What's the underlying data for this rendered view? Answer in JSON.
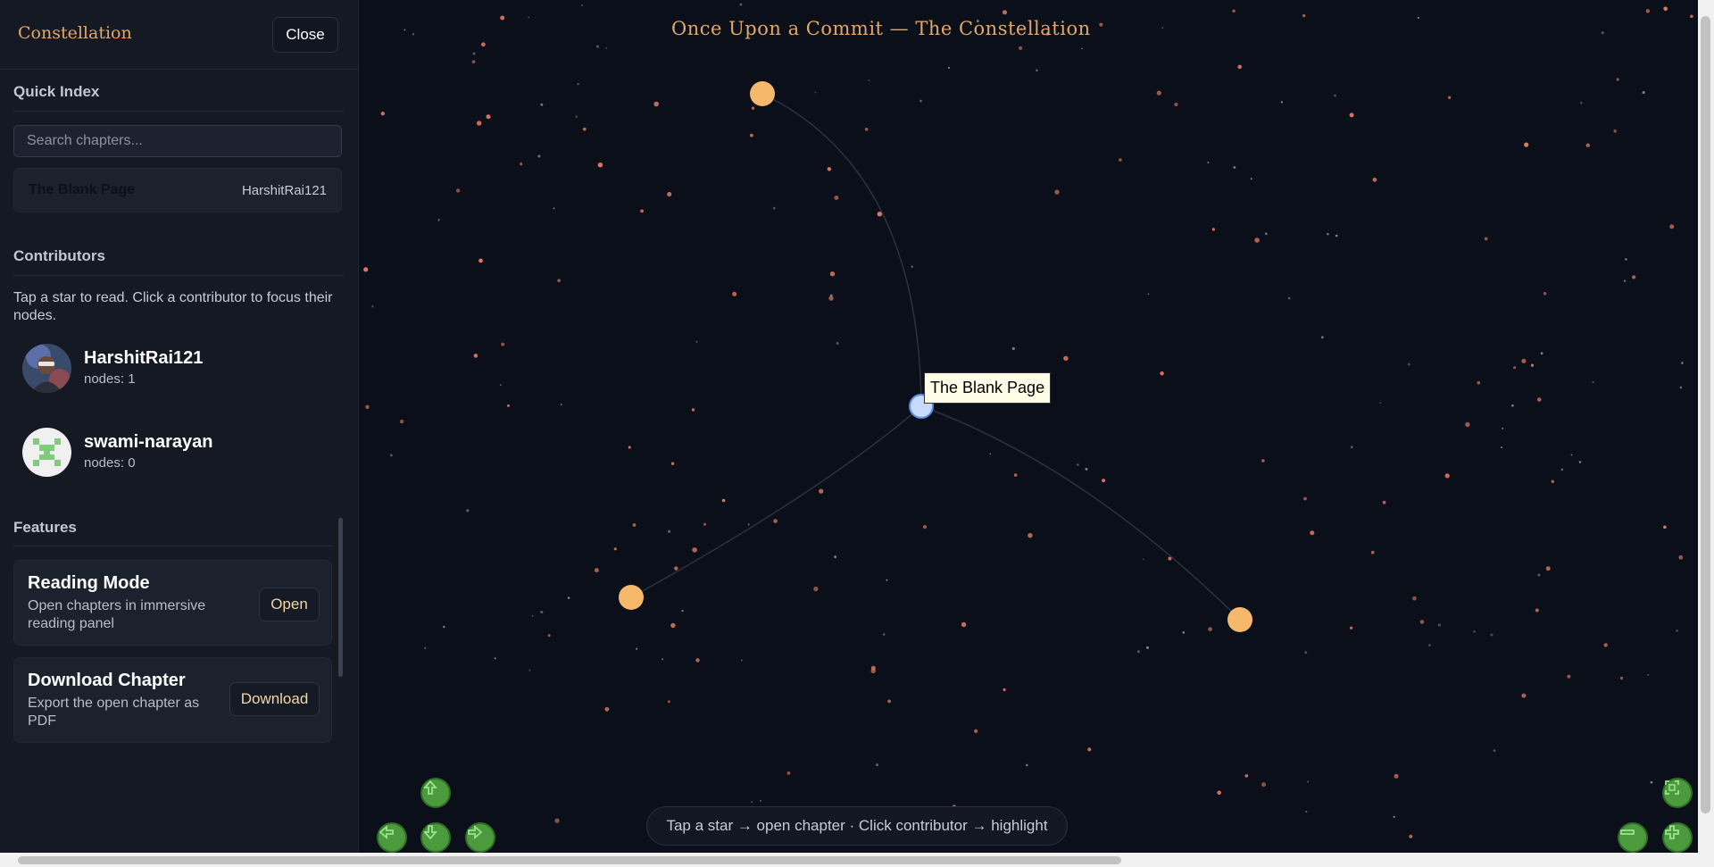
{
  "sidebar": {
    "brand": "Constellation",
    "close_label": "Close",
    "quick_index": {
      "title": "Quick Index",
      "search_placeholder": "Search chapters...",
      "items": [
        {
          "title": "The Blank Page",
          "author": "HarshitRai121"
        }
      ]
    },
    "contributors": {
      "title": "Contributors",
      "help": "Tap a star to read. Click a contributor to focus their nodes.",
      "items": [
        {
          "name": "HarshitRai121",
          "count": "nodes: 1"
        },
        {
          "name": "swami-narayan",
          "count": "nodes: 0"
        }
      ]
    },
    "features": {
      "title": "Features",
      "items": [
        {
          "title": "Reading Mode",
          "desc": "Open chapters in immersive reading panel",
          "button": "Open"
        },
        {
          "title": "Download Chapter",
          "desc": "Export the open chapter as PDF",
          "button": "Download"
        }
      ]
    }
  },
  "main": {
    "title": "Once Upon a Commit — The Constellation",
    "tooltip": "The Blank Page",
    "hint": "Tap a star → open chapter · Click contributor → highlight"
  },
  "colors": {
    "accent": "#e3a867",
    "star": "#f6b96b",
    "active_node": "#c7dafc",
    "control": "#4c9a3e"
  },
  "icons": [
    "arrow-up-icon",
    "arrow-left-icon",
    "arrow-down-icon",
    "arrow-right-icon",
    "fit-view-icon",
    "zoom-out-icon",
    "zoom-in-icon"
  ]
}
